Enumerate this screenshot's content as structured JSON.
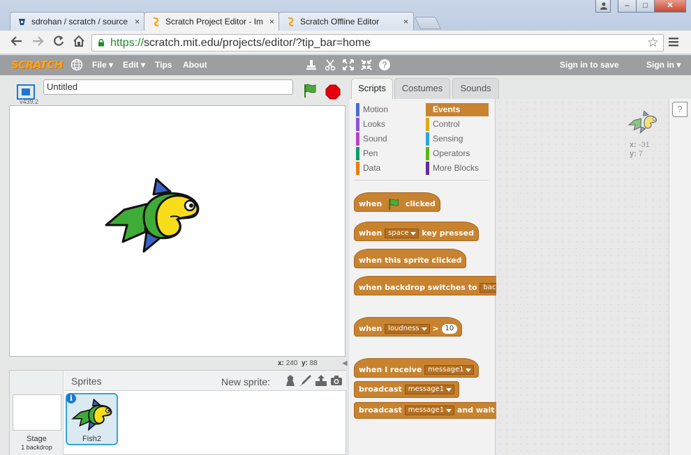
{
  "browser": {
    "tabs": [
      {
        "label": "sdrohan / scratch / source",
        "close": "×"
      },
      {
        "label": "Scratch Project Editor - Im",
        "close": "×"
      },
      {
        "label": "Scratch Offline Editor",
        "close": "×"
      }
    ],
    "url_scheme": "https://",
    "url_rest": "scratch.mit.edu/projects/editor/?tip_bar=home",
    "window_buttons": {
      "minimize": "–",
      "maximize": "□",
      "close": "✕"
    }
  },
  "menubar": {
    "logo": "SCRATCH",
    "items": [
      "File ▾",
      "Edit ▾",
      "Tips",
      "About"
    ],
    "sign_in_to_save": "Sign in to save",
    "sign_in": "Sign in ▾"
  },
  "stage": {
    "project_title": "Untitled",
    "version": "v439.2",
    "mouse_x_label": "x:",
    "mouse_x": "240",
    "mouse_y_label": "y:",
    "mouse_y": "88"
  },
  "sprites": {
    "header": "Sprites",
    "new_sprite": "New sprite:",
    "stage_label": "Stage",
    "backdrop_count": "1 backdrop",
    "sprite_name": "Fish2",
    "info": "i"
  },
  "editor_tabs": [
    "Scripts",
    "Costumes",
    "Sounds"
  ],
  "categories": [
    {
      "label": "Motion",
      "color": "#4a6cd4"
    },
    {
      "label": "Events",
      "color": "#c88330"
    },
    {
      "label": "Looks",
      "color": "#8a55d7"
    },
    {
      "label": "Control",
      "color": "#e1a91a"
    },
    {
      "label": "Sound",
      "color": "#bb42c3"
    },
    {
      "label": "Sensing",
      "color": "#2ca5e2"
    },
    {
      "label": "Pen",
      "color": "#0e9a6c"
    },
    {
      "label": "Operators",
      "color": "#5cb712"
    },
    {
      "label": "Data",
      "color": "#ee7d16"
    },
    {
      "label": "More Blocks",
      "color": "#632d99"
    }
  ],
  "blocks": {
    "when_flag": {
      "pre": "when",
      "post": "clicked"
    },
    "when_key": {
      "pre": "when",
      "key": "space",
      "post": "key pressed"
    },
    "when_sprite": {
      "text": "when this sprite clicked"
    },
    "when_backdrop": {
      "pre": "when backdrop switches to",
      "value": "backd"
    },
    "when_loudness": {
      "pre": "when",
      "sensor": "loudness",
      "op": ">",
      "value": "10"
    },
    "when_receive": {
      "pre": "when I receive",
      "msg": "message1"
    },
    "broadcast": {
      "pre": "broadcast",
      "msg": "message1"
    },
    "broadcast_wait": {
      "pre": "broadcast",
      "msg": "message1",
      "post": "and wait"
    }
  },
  "scripts_area": {
    "x_label": "x:",
    "x_value": "-31",
    "y_label": "y:",
    "y_value": "7"
  },
  "help": "?"
}
